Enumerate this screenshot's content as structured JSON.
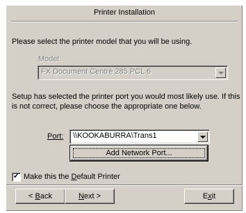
{
  "dialog": {
    "title": "Printer Installation",
    "instruction": "Please select the printer model that you will be using.",
    "model_label": "Model:",
    "model_value": "FX Document Centre 285 PCL 6",
    "port_hint_line1": "Setup has selected the printer port you would most likely use. If this",
    "port_hint_line2": "is not correct, please choose the appropriate one below.",
    "port_label": "Port:",
    "port_value": "\\\\KOOKABURRA\\Trans1",
    "add_network_port": "Add Network Port...",
    "default_printer": {
      "label_pre": "Make this the ",
      "label_accel": "D",
      "label_post": "efault Printer",
      "checked": true,
      "check_glyph": "✓"
    },
    "buttons": {
      "back_pre": "< ",
      "back_accel": "B",
      "back_post": "ack",
      "next_accel": "N",
      "next_post": "ext >",
      "exit_pre": "E",
      "exit_accel": "x",
      "exit_post": "it"
    }
  }
}
